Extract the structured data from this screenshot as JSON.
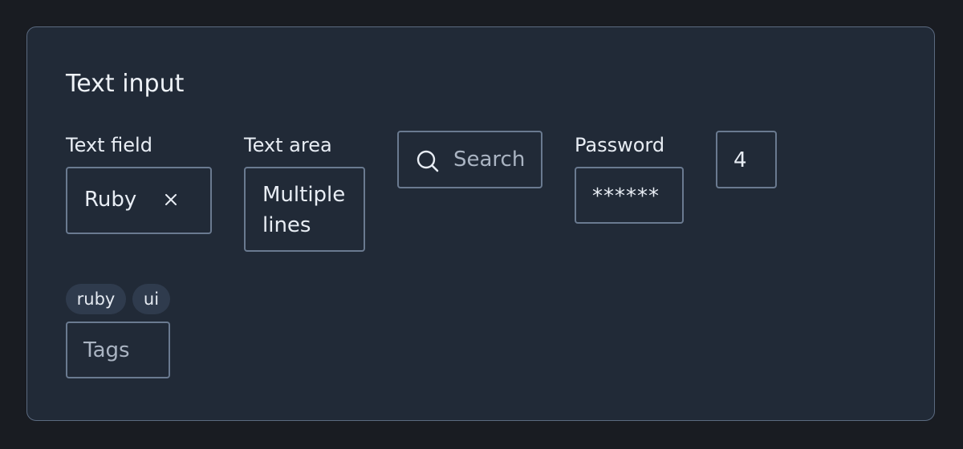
{
  "section": {
    "title": "Text input"
  },
  "text_field": {
    "label": "Text field",
    "value": "Ruby",
    "clear_icon": "close-icon"
  },
  "text_area": {
    "label": "Text area",
    "value_line1": "Multiple",
    "value_line2": "lines"
  },
  "search": {
    "icon": "search-icon",
    "placeholder": "Search"
  },
  "password": {
    "label": "Password",
    "value": "******"
  },
  "number": {
    "value": "4"
  },
  "tags": {
    "chips": [
      "ruby",
      "ui"
    ],
    "placeholder": "Tags"
  }
}
